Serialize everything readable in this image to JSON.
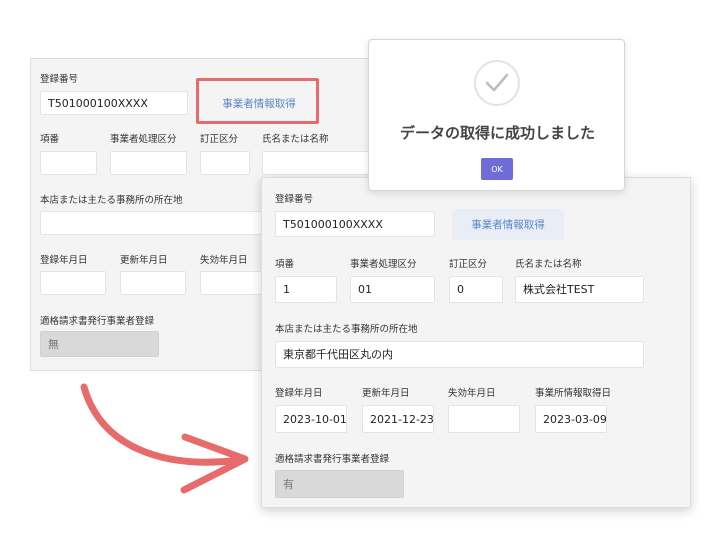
{
  "before": {
    "reg_label": "登録番号",
    "reg_value": "T501000100XXXX",
    "fetch_label": "事業者情報取得",
    "col_item": "項番",
    "col_proc": "事業者処理区分",
    "col_corr": "訂正区分",
    "col_name": "氏名または名称",
    "address_label": "本店または主たる事務所の所在地",
    "date_reg": "登録年月日",
    "date_upd": "更新年月日",
    "date_exp": "失効年月日",
    "invoice_label": "適格請求書発行事業者登録",
    "invoice_value": "無"
  },
  "after": {
    "reg_label": "登録番号",
    "reg_value": "T501000100XXXX",
    "fetch_label": "事業者情報取得",
    "col_item": "項番",
    "col_proc": "事業者処理区分",
    "col_corr": "訂正区分",
    "col_name": "氏名または名称",
    "item_value": "1",
    "proc_value": "01",
    "corr_value": "0",
    "name_value": "株式会社TEST",
    "address_label": "本店または主たる事務所の所在地",
    "address_value": "東京都千代田区丸の内",
    "date_reg": "登録年月日",
    "date_upd": "更新年月日",
    "date_exp": "失効年月日",
    "date_fetch": "事業所情報取得日",
    "reg_date_value": "2023-10-01",
    "upd_date_value": "2021-12-23",
    "exp_date_value": "",
    "fetch_date_value": "2023-03-09",
    "invoice_label": "適格請求書発行事業者登録",
    "invoice_value": "有"
  },
  "dialog": {
    "message": "データの取得に成功しました",
    "ok_label": "OK"
  },
  "colors": {
    "highlight": "#e76b6b",
    "arrow": "#e76b6b",
    "ok_button": "#6e6cd8",
    "fetch_text": "#5a87c6"
  },
  "icons": {
    "dialog": "check-circle-icon",
    "flow": "curved-arrow-icon"
  }
}
